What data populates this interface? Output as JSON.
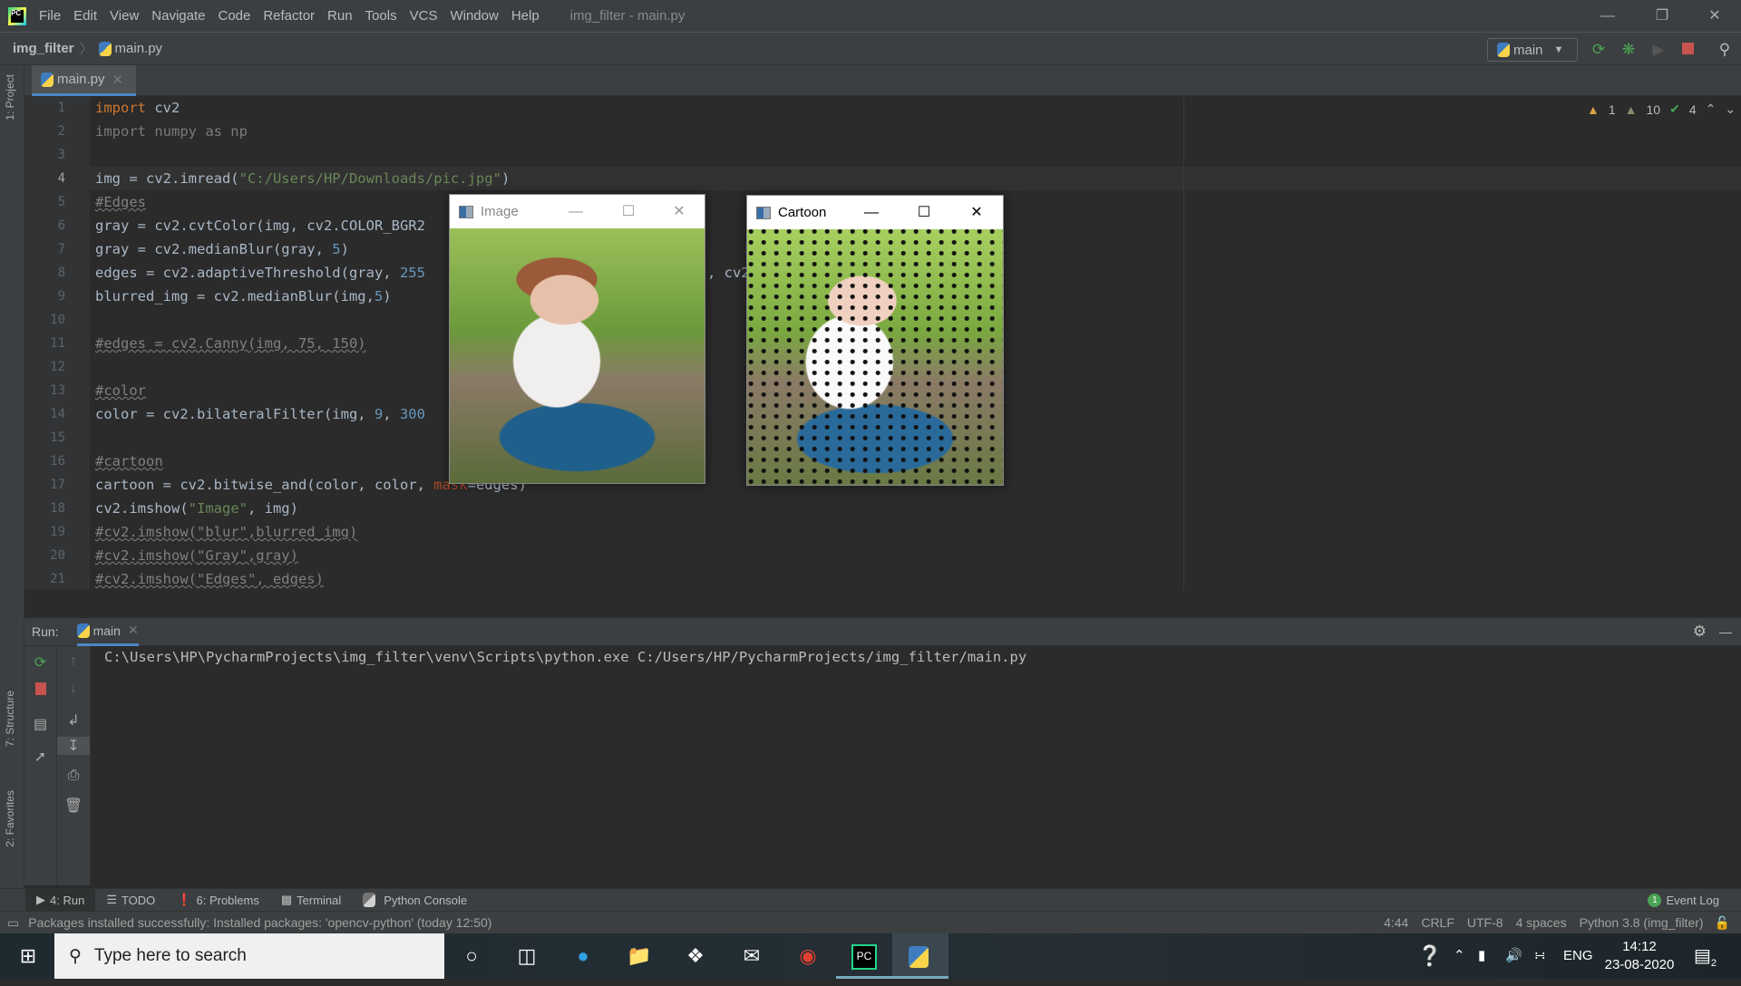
{
  "titlebar": {
    "menus": [
      "File",
      "Edit",
      "View",
      "Navigate",
      "Code",
      "Refactor",
      "Run",
      "Tools",
      "VCS",
      "Window",
      "Help"
    ],
    "window_title": "img_filter - main.py"
  },
  "navbar": {
    "project": "img_filter",
    "file": "main.py",
    "run_config": "main"
  },
  "sidebar": {
    "project": "1: Project",
    "structure": "7: Structure",
    "favorites": "2: Favorites"
  },
  "tabs": [
    {
      "label": "main.py"
    }
  ],
  "inspections": {
    "warnings": "1",
    "weak_warnings": "10",
    "typos": "4"
  },
  "code": {
    "l1": [
      "import",
      " cv2"
    ],
    "l2": "import numpy as np",
    "l4": [
      "img = cv2.imread(",
      "\"C:/Users/HP/Downloads/pic.jpg\"",
      ")"
    ],
    "l5": "#Edges",
    "l6": "gray = cv2.cvtColor(img, cv2.COLOR_BGR2",
    "l7": [
      "gray = cv2.medianBlur(gray, ",
      "5",
      ")"
    ],
    "l8": [
      "edges = cv2.adaptiveThreshold(gray, ",
      "255"
    ],
    "l8b": ", cv2",
    "l9": [
      "blurred_img = cv2.medianBlur(img,",
      "5",
      ")"
    ],
    "l11": "#edges = cv2.Canny(img, 75, 150)",
    "l13": "#color",
    "l14": [
      "color = cv2.bilateralFilter(img, ",
      "9",
      ", ",
      "300"
    ],
    "l16": "#cartoon",
    "l17": [
      "cartoon = cv2.bitwise_and(color, color, ",
      "mask",
      "=edges)"
    ],
    "l18": [
      "cv2.imshow(",
      "\"Image\"",
      ", img)"
    ],
    "l19": "#cv2.imshow(\"blur\",blurred_img)",
    "l20": "#cv2.imshow(\"Gray\",gray)",
    "l21": "#cv2.imshow(\"Edges\", edges)",
    "line_numbers": [
      "1",
      "2",
      "3",
      "4",
      "5",
      "6",
      "7",
      "8",
      "9",
      "10",
      "11",
      "12",
      "13",
      "14",
      "15",
      "16",
      "17",
      "18",
      "19",
      "20",
      "21"
    ]
  },
  "windows": {
    "image_title": "Image",
    "cartoon_title": "Cartoon"
  },
  "run": {
    "label": "Run:",
    "tab": "main",
    "output": "C:\\Users\\HP\\PycharmProjects\\img_filter\\venv\\Scripts\\python.exe C:/Users/HP/PycharmProjects/img_filter/main.py"
  },
  "bottom_tools": [
    "4: Run",
    "TODO",
    "6: Problems",
    "Terminal",
    "Python Console"
  ],
  "event_log": {
    "count": "1",
    "label": "Event Log"
  },
  "status": {
    "message": "Packages installed successfully: Installed packages: 'opencv-python' (today 12:50)",
    "position": "4:44",
    "line_sep": "CRLF",
    "encoding": "UTF-8",
    "indent": "4 spaces",
    "interpreter": "Python 3.8 (img_filter)"
  },
  "taskbar": {
    "search_placeholder": "Type here to search",
    "lang": "ENG",
    "time": "14:12",
    "date": "23-08-2020",
    "notifications": "2"
  }
}
